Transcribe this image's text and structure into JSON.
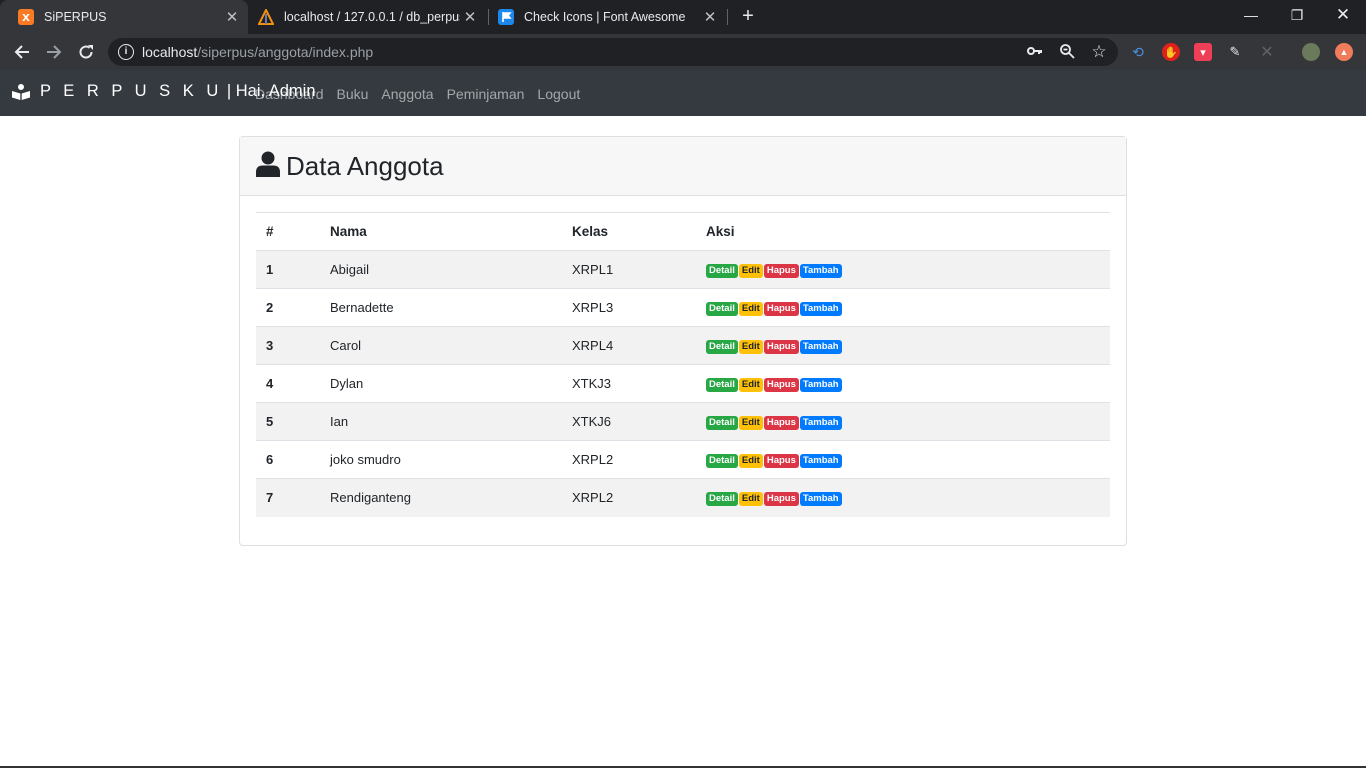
{
  "browser": {
    "tabs": [
      {
        "title": "SiPERPUS",
        "active": true,
        "icon": "xampp-icon"
      },
      {
        "title": "localhost / 127.0.0.1 / db_perpus",
        "active": false,
        "icon": "phpmyadmin-icon"
      },
      {
        "title": "Check Icons | Font Awesome",
        "active": false,
        "icon": "flag-icon"
      }
    ],
    "url_host": "localhost",
    "url_path": "/siperpus/anggota/index.php"
  },
  "navbar": {
    "brand_spaced": "P E R P U S K U",
    "brand_rest": " | Hai, Admin",
    "links": [
      "Dashboard",
      "Buku",
      "Anggota",
      "Peminjaman",
      "Logout"
    ]
  },
  "page": {
    "title": "Data Anggota",
    "columns": [
      "#",
      "Nama",
      "Kelas",
      "Aksi"
    ],
    "actions": [
      "Detail",
      "Edit",
      "Hapus",
      "Tambah"
    ],
    "rows": [
      {
        "no": "1",
        "nama": "Abigail",
        "kelas": "XRPL1"
      },
      {
        "no": "2",
        "nama": "Bernadette",
        "kelas": "XRPL3"
      },
      {
        "no": "3",
        "nama": "Carol",
        "kelas": "XRPL4"
      },
      {
        "no": "4",
        "nama": "Dylan",
        "kelas": "XTKJ3"
      },
      {
        "no": "5",
        "nama": "Ian",
        "kelas": "XTKJ6"
      },
      {
        "no": "6",
        "nama": "joko smudro",
        "kelas": "XRPL2"
      },
      {
        "no": "7",
        "nama": "Rendiganteng",
        "kelas": "XRPL2"
      }
    ]
  },
  "colors": {
    "navbar_bg": "#343a40",
    "detail": "#28a745",
    "edit": "#ffc107",
    "hapus": "#dc3545",
    "tambah": "#007bff"
  }
}
